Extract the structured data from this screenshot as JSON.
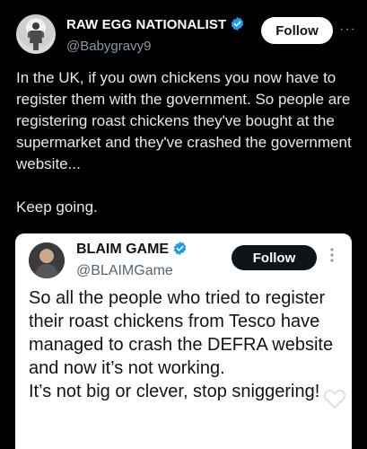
{
  "post": {
    "display_name": "RAW EGG NATIONALIST",
    "handle": "@Babygravy9",
    "follow_label": "Follow",
    "more_label": "···",
    "text_paragraphs": [
      "In the UK, if you own chickens you now have to register them with the government. So people are registering roast chickens they've bought at the supermarket and they've crashed the government website...",
      "Keep going."
    ]
  },
  "quoted_post": {
    "display_name": "BLAIM GAME",
    "handle": "@BLAIMGame",
    "follow_label": "Follow",
    "text_lines": [
      "So all the people who tried to register their roast chickens from Tesco have managed to crash the DEFRA website and now it’s not working.",
      "It’s not big or clever, stop sniggering!"
    ]
  },
  "icons": {
    "verified": "verified-badge-icon",
    "more": "more-options-icon",
    "like": "heart-icon"
  },
  "colors": {
    "background": "#000000",
    "text": "#e7e9ea",
    "secondary_text": "#8b98a5",
    "verified": "#1d9bf0",
    "follow_button_bg": "#ffffff",
    "quote_card_bg": "#ffffff",
    "quote_follow_bg": "#0f1419"
  }
}
